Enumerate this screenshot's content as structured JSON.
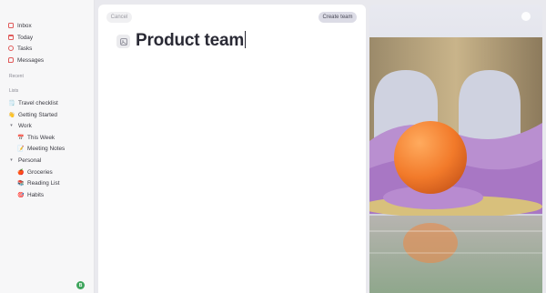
{
  "sidebar": {
    "nav": [
      {
        "label": "Inbox",
        "icon": "inbox-icon",
        "color": "#e05a5a"
      },
      {
        "label": "Today",
        "icon": "calendar-icon",
        "color": "#e05a5a"
      },
      {
        "label": "Tasks",
        "icon": "tasks-icon",
        "color": "#e05a5a"
      },
      {
        "label": "Messages",
        "icon": "messages-icon",
        "color": "#e05a5a"
      }
    ],
    "recent_label": "Recent",
    "lists_label": "Lists",
    "lists": [
      {
        "label": "Travel checklist",
        "emoji": "🗒️"
      },
      {
        "label": "Getting Started",
        "emoji": "👋"
      }
    ],
    "groups": [
      {
        "label": "Work",
        "items": [
          {
            "label": "This Week",
            "emoji": "📅"
          },
          {
            "label": "Meeting Notes",
            "emoji": "📝"
          }
        ]
      },
      {
        "label": "Personal",
        "items": [
          {
            "label": "Groceries",
            "emoji": "🍎"
          },
          {
            "label": "Reading List",
            "emoji": "📚"
          },
          {
            "label": "Habits",
            "emoji": "🎯"
          }
        ]
      }
    ],
    "avatar_initial": "B"
  },
  "main": {
    "cancel_label": "Cancel",
    "create_label": "Create team",
    "title_value": "Product team"
  }
}
